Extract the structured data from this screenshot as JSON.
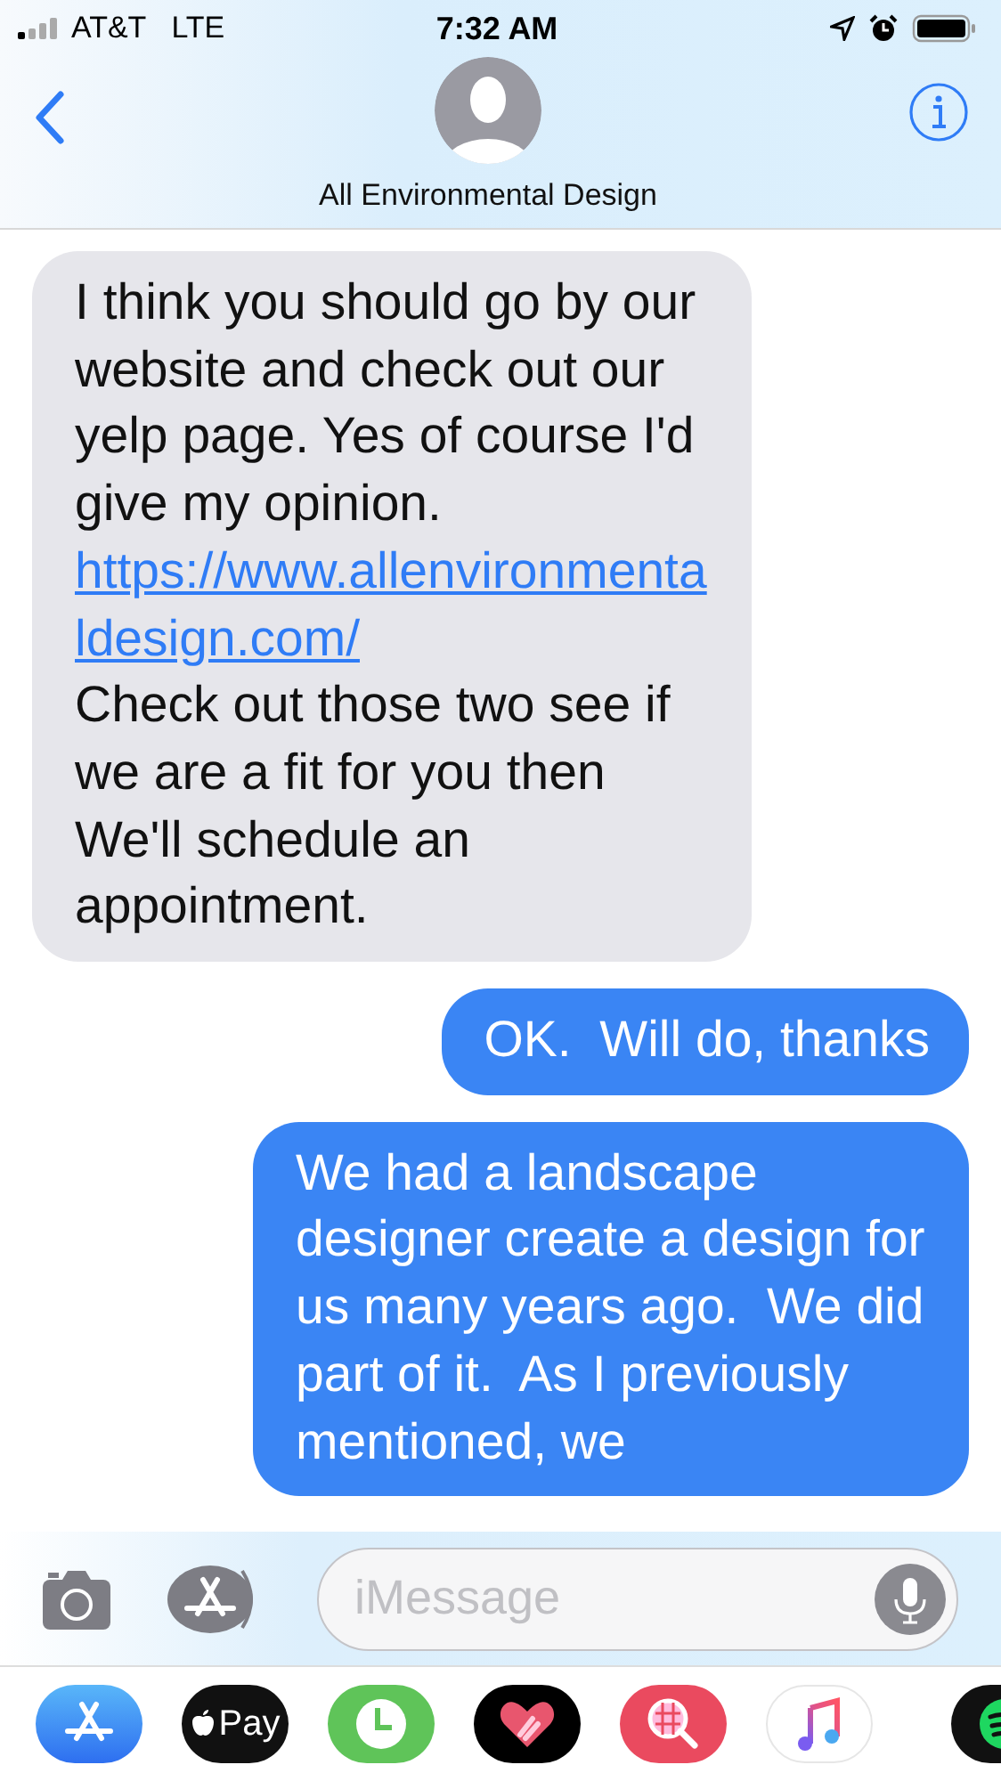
{
  "status_bar": {
    "carrier": "AT&T",
    "network": "LTE",
    "time": "7:32 AM"
  },
  "header": {
    "contact_name": "All Environmental Design"
  },
  "messages": [
    {
      "sent": false,
      "parts": [
        {
          "kind": "text",
          "text": "I think you should go by our website and check out our yelp page. Yes of course I'd give my opinion."
        },
        {
          "kind": "link",
          "text": "https://www.allenvironmentaldesign.com/"
        },
        {
          "kind": "text",
          "text": "Check out those two see if we are a fit for you then We'll schedule an appointment."
        }
      ]
    },
    {
      "sent": true,
      "parts": [
        {
          "kind": "text",
          "text": "OK.  Will do, thanks"
        }
      ]
    },
    {
      "sent": true,
      "parts": [
        {
          "kind": "text",
          "text": "We had a landscape designer create a design for us many years ago.  We did part of it.  As I previously mentioned, we"
        }
      ]
    }
  ],
  "composer": {
    "placeholder": "iMessage"
  },
  "app_drawer": [
    {
      "kind": "appstore"
    },
    {
      "kind": "pay",
      "label": "Pay"
    },
    {
      "kind": "clock"
    },
    {
      "kind": "heart"
    },
    {
      "kind": "search"
    },
    {
      "kind": "music"
    },
    {
      "kind": "spotify"
    }
  ]
}
